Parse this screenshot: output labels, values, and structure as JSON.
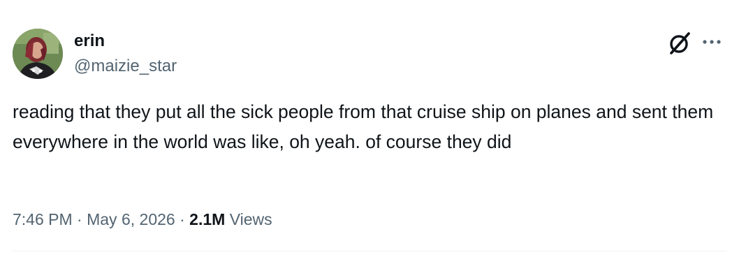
{
  "author": {
    "display_name": "erin",
    "handle": "@maizie_star"
  },
  "tweet": {
    "text": "reading that they put all the sick people from that cruise ship on planes and sent them everywhere in the world was like, oh yeah. of course they did"
  },
  "meta": {
    "time": "7:46 PM",
    "separator": "·",
    "date": "May 6, 2026",
    "views_count": "2.1M",
    "views_label": "Views"
  },
  "icons": {
    "avatar": "profile-photo",
    "grok": "grok-icon",
    "more": "more-horizontal-icon"
  },
  "colors": {
    "text_primary": "#0f1419",
    "text_secondary": "#536471",
    "divider": "#eff3f4"
  }
}
